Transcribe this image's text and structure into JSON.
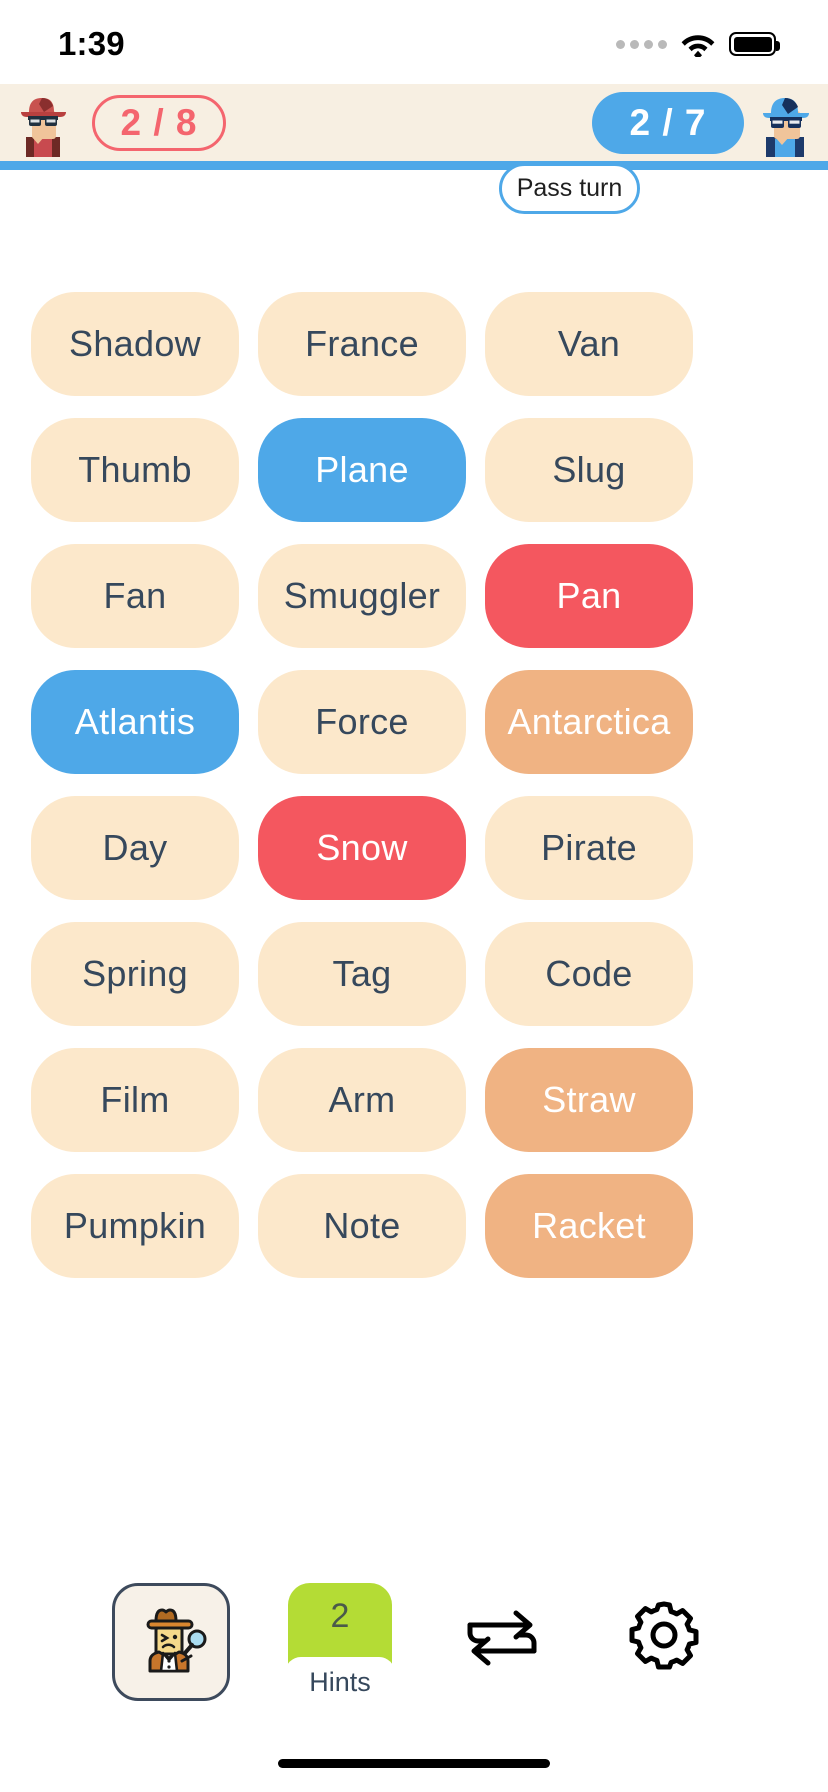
{
  "status_bar": {
    "time": "1:39",
    "cellular_icon": "cellular-dots-icon",
    "wifi_icon": "wifi-icon",
    "battery_icon": "battery-full-icon"
  },
  "top_bar": {
    "red_team": {
      "avatar_icon": "red-spy-avatar",
      "score": "2 / 8",
      "color": "#f4656e"
    },
    "blue_team": {
      "avatar_icon": "blue-spy-avatar",
      "score": "2 / 7",
      "color": "#4ea8e8"
    },
    "active_turn_color": "#4ea8e8",
    "pass_turn_label": "Pass turn"
  },
  "board": {
    "columns": 3,
    "legend": {
      "neutral": "#fce8cb",
      "blue": "#4ea8e8",
      "red": "#f4575f",
      "tan": "#f0b383",
      "text_dark": "#36485c",
      "text_light": "#ffffff"
    },
    "cards": [
      {
        "word": "Shadow",
        "state": "neutralcream"
      },
      {
        "word": "France",
        "state": "neutralcream"
      },
      {
        "word": "Van",
        "state": "neutralcream"
      },
      {
        "word": "Thumb",
        "state": "neutralcream"
      },
      {
        "word": "Plane",
        "state": "blue"
      },
      {
        "word": "Slug",
        "state": "neutralcream"
      },
      {
        "word": "Fan",
        "state": "neutralcream"
      },
      {
        "word": "Smuggler",
        "state": "neutralcream"
      },
      {
        "word": "Pan",
        "state": "red"
      },
      {
        "word": "Atlantis",
        "state": "blue"
      },
      {
        "word": "Force",
        "state": "neutralcream"
      },
      {
        "word": "Antarctica",
        "state": "tan"
      },
      {
        "word": "Day",
        "state": "neutralcream"
      },
      {
        "word": "Snow",
        "state": "red"
      },
      {
        "word": "Pirate",
        "state": "neutralcream"
      },
      {
        "word": "Spring",
        "state": "neutralcream"
      },
      {
        "word": "Tag",
        "state": "neutralcream"
      },
      {
        "word": "Code",
        "state": "neutralcream"
      },
      {
        "word": "Film",
        "state": "neutralcream"
      },
      {
        "word": "Arm",
        "state": "neutralcream"
      },
      {
        "word": "Straw",
        "state": "tan"
      },
      {
        "word": "Pumpkin",
        "state": "neutralcream"
      },
      {
        "word": "Note",
        "state": "neutralcream"
      },
      {
        "word": "Racket",
        "state": "tan"
      }
    ]
  },
  "toolbar": {
    "spymaster_icon": "detective-magnifier-icon",
    "hints_count": "2",
    "hints_label": "Hints",
    "hints_color": "#b4dc35",
    "swap_icon": "swap-arrows-icon",
    "settings_icon": "gear-icon"
  }
}
